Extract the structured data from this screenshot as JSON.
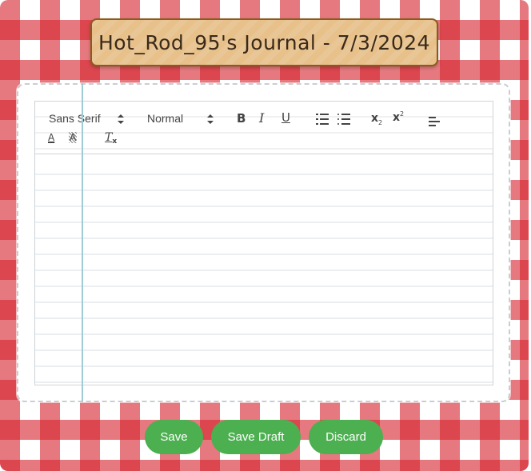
{
  "journal": {
    "title": "Hot_Rod_95's Journal - 7/3/2024"
  },
  "toolbar": {
    "font_family": "Sans Serif",
    "font_size": "Normal",
    "bold_label": "B",
    "italic_label": "I",
    "underline_label": "U",
    "subscript_label": "x",
    "subscript_mark": "2",
    "superscript_label": "x",
    "superscript_mark": "2",
    "text_color_label": "A",
    "background_color_label": "A",
    "clean_label": "T",
    "clean_mark": "x",
    "icons": [
      "bold-icon",
      "italic-icon",
      "underline-icon",
      "ordered-list-icon",
      "bullet-list-icon",
      "subscript-icon",
      "superscript-icon",
      "align-icon",
      "text-color-icon",
      "background-color-icon",
      "clear-format-icon"
    ]
  },
  "editor": {
    "content": ""
  },
  "actions": {
    "save_label": "Save",
    "save_draft_label": "Save Draft",
    "discard_label": "Discard"
  },
  "colors": {
    "gingham_red": "#d62730",
    "title_card": "#e7c08a",
    "button_green": "#4caf50",
    "margin_line": "#9fcbd4"
  }
}
